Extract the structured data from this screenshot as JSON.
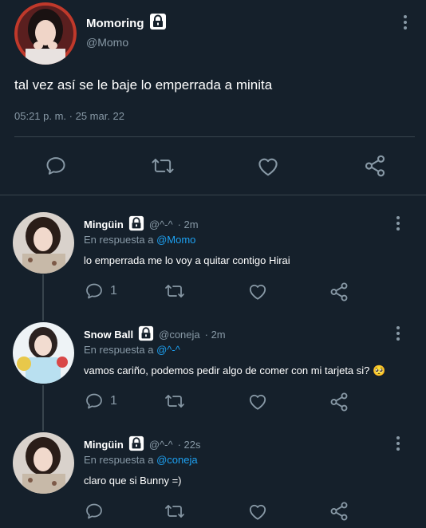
{
  "main_tweet": {
    "display_name": "Momoring",
    "handle": "@Momo",
    "text": "tal vez así se le baje lo emperrada a minita",
    "timestamp": "05:21 p. m. · 25 mar. 22"
  },
  "replies": [
    {
      "display_name": "Mingüin",
      "handle": "@^-^",
      "time": "· 2m",
      "reply_prefix": "En respuesta a",
      "reply_to": "@Momo",
      "text": "lo emperrada me lo voy a quitar contigo Hirai",
      "reply_count": "1"
    },
    {
      "display_name": "Snow Ball",
      "handle": "@coneja",
      "time": "· 2m",
      "reply_prefix": "En respuesta a",
      "reply_to": "@^-^",
      "text": "vamos cariño, podemos pedir algo de comer con mi tarjeta si? 🥺",
      "reply_count": "1"
    },
    {
      "display_name": "Mingüin",
      "handle": "@^-^",
      "time": "· 22s",
      "reply_prefix": "En respuesta a",
      "reply_to": "@coneja",
      "text": "claro que si Bunny =)",
      "reply_count": ""
    }
  ],
  "colors": {
    "background": "#15202b",
    "muted": "#8899a6",
    "link": "#1da1f2",
    "divider": "#38444d"
  },
  "icons": [
    "reply-icon",
    "retweet-icon",
    "like-icon",
    "share-icon",
    "lock-icon",
    "more-icon"
  ]
}
